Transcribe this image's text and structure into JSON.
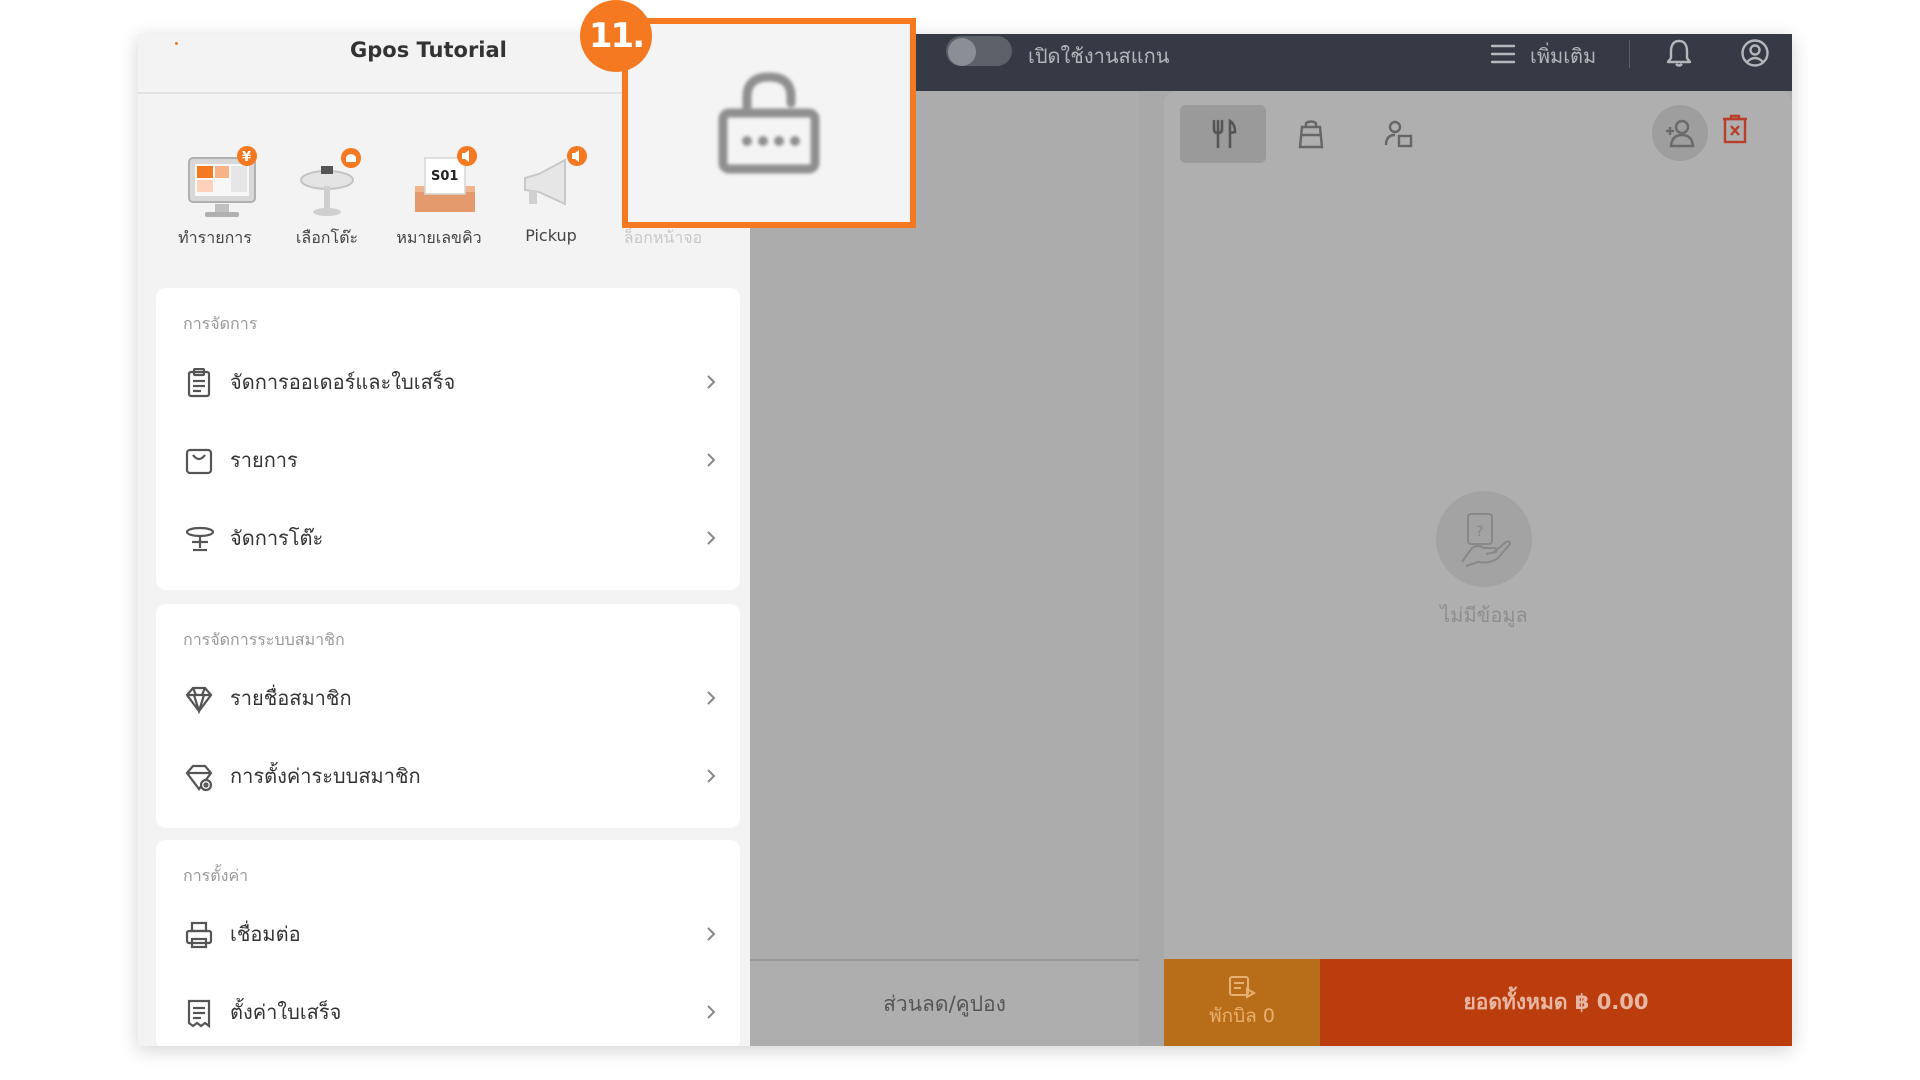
{
  "topbar": {
    "scanner_label": "เปิดใช้งานสแกน",
    "more_label": "เพิ่มเติม",
    "colors": {
      "bg": "#353a44",
      "text": "#b4b6ba"
    }
  },
  "sidebar": {
    "title": "Gpos Tutorial",
    "quick_actions": [
      {
        "label": "ทำรายการ",
        "icon": "pos-monitor-icon"
      },
      {
        "label": "เลือกโต๊ะ",
        "icon": "table-icon"
      },
      {
        "label": "หมายเลขคิว",
        "icon": "queue-ticket-icon",
        "ticket_text": "S01"
      },
      {
        "label": "Pickup",
        "icon": "megaphone-icon"
      },
      {
        "label": "ล็อกหน้าจอ",
        "icon": "lock-screen-icon"
      }
    ],
    "sections": [
      {
        "title": "การจัดการ",
        "items": [
          {
            "label": "จัดการออเดอร์และใบเสร็จ",
            "icon": "clipboard-icon"
          },
          {
            "label": "รายการ",
            "icon": "bag-icon"
          },
          {
            "label": "จัดการโต๊ะ",
            "icon": "table-manage-icon"
          }
        ]
      },
      {
        "title": "การจัดการระบบสมาชิก",
        "items": [
          {
            "label": "รายชื่อสมาชิก",
            "icon": "diamond-icon"
          },
          {
            "label": "การตั้งค่าระบบสมาชิก",
            "icon": "diamond-gear-icon"
          }
        ]
      },
      {
        "title": "การตั้งค่า",
        "items": [
          {
            "label": "เชื่อมต่อ",
            "icon": "printer-icon"
          },
          {
            "label": "ตั้งค่าใบเสร็จ",
            "icon": "receipt-icon"
          }
        ]
      }
    ]
  },
  "middle": {
    "discount_label": "ส่วนลด/คูปอง"
  },
  "order": {
    "empty_label": "ไม่มีข้อมูล",
    "hold_bill_label": "พักบิล 0",
    "total_label": "ยอดทั้งหมด ฿ 0.00",
    "colors": {
      "hold": "#b86e19",
      "total": "#bb3c0d"
    }
  },
  "annotation": {
    "step": "11.",
    "accent": "#f47920"
  }
}
